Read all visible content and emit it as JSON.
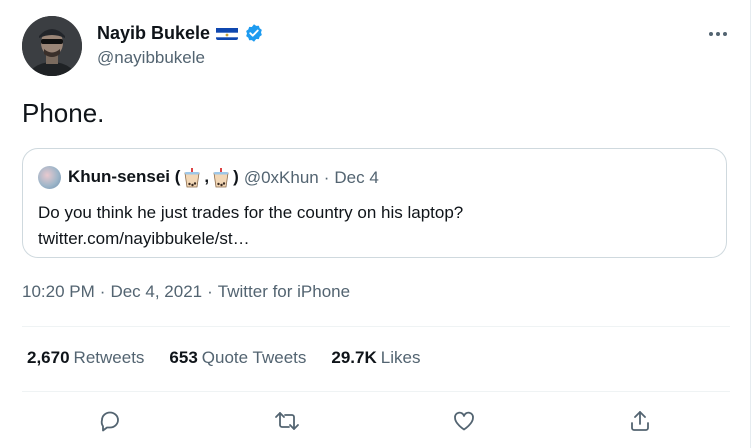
{
  "tweet": {
    "author": {
      "display_name": "Nayib Bukele",
      "handle": "@nayibbukele"
    },
    "text": "Phone.",
    "quoted": {
      "author_name_prefix": "Khun-sensei (",
      "author_name_comma": ",",
      "author_name_suffix": ")",
      "handle": "@0xKhun",
      "separator": "·",
      "date": "Dec 4",
      "text": "Do you think he just trades for the country on his laptop?",
      "link": "twitter.com/nayibbukele/st…"
    },
    "meta": {
      "time": "10:20 PM",
      "sep1": "·",
      "date": "Dec 4, 2021",
      "sep2": "·",
      "source": "Twitter for iPhone"
    },
    "stats": [
      {
        "count": "2,670",
        "label": "Retweets"
      },
      {
        "count": "653",
        "label": "Quote Tweets"
      },
      {
        "count": "29.7K",
        "label": "Likes"
      }
    ],
    "actions": [
      {
        "icon": "reply-icon"
      },
      {
        "icon": "retweet-icon"
      },
      {
        "icon": "like-icon"
      },
      {
        "icon": "share-icon"
      }
    ]
  },
  "colors": {
    "text_primary": "#0f1419",
    "text_secondary": "#536471",
    "verified_blue": "#1d9bf0",
    "border": "#cfd9de"
  }
}
